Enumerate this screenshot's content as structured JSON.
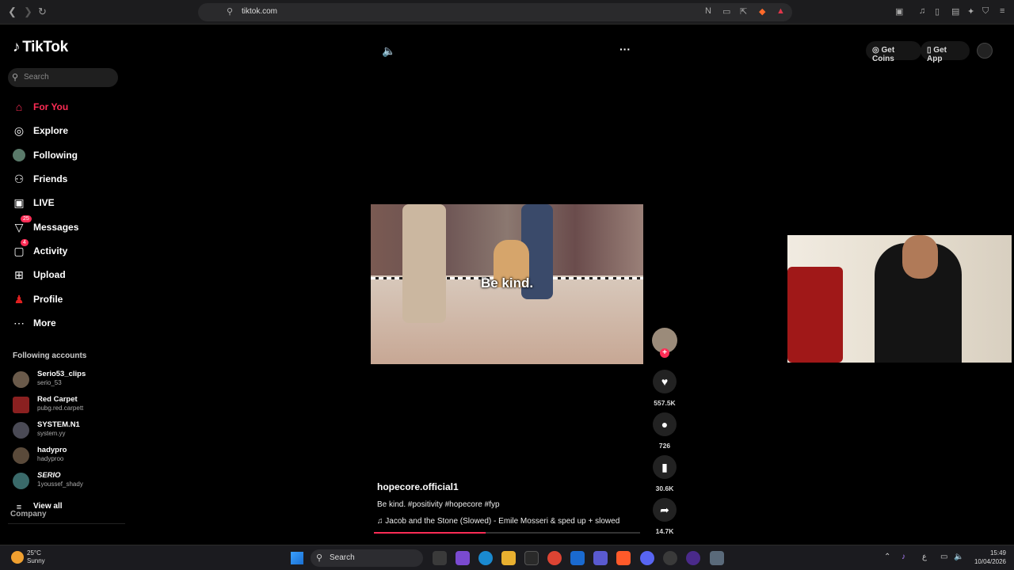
{
  "browser": {
    "url": "tiktok.com"
  },
  "sidebar": {
    "logo": "TikTok",
    "search_placeholder": "Search",
    "nav": [
      {
        "label": "For You",
        "icon": "home-icon",
        "badge": ""
      },
      {
        "label": "Explore",
        "icon": "compass-icon",
        "badge": ""
      },
      {
        "label": "Following",
        "icon": "following-icon",
        "badge": ""
      },
      {
        "label": "Friends",
        "icon": "friends-icon",
        "badge": ""
      },
      {
        "label": "LIVE",
        "icon": "live-icon",
        "badge": ""
      },
      {
        "label": "Messages",
        "icon": "messages-icon",
        "badge": "25"
      },
      {
        "label": "Activity",
        "icon": "activity-icon",
        "badge": "4"
      },
      {
        "label": "Upload",
        "icon": "upload-icon",
        "badge": ""
      },
      {
        "label": "Profile",
        "icon": "profile-icon",
        "badge": ""
      },
      {
        "label": "More",
        "icon": "more-icon",
        "badge": ""
      }
    ],
    "following_title": "Following accounts",
    "accounts": [
      {
        "name": "Serio53_clips",
        "handle": "serio_53"
      },
      {
        "name": "Red Carpet",
        "handle": "pubg.red.carpett"
      },
      {
        "name": "SYSTEM.N1",
        "handle": "system.yy"
      },
      {
        "name": "hadypro",
        "handle": "hadyproo"
      },
      {
        "name": "SERIO",
        "handle": "1youssef_shady"
      }
    ],
    "view_all": "View all",
    "company": "Company"
  },
  "header": {
    "get_coins": "Get Coins",
    "get_app": "Get App"
  },
  "video": {
    "caption_overlay": "Be kind.",
    "author": "hopecore.official1",
    "description": "Be kind. #positivity #hopecore #fyp",
    "music": "Jacob and the Stone (Slowed) - Emile Mosseri & sped up + slowed",
    "progress": 0.42
  },
  "actions": {
    "likes": "557.5K",
    "comments": "726",
    "saves": "30.6K",
    "shares": "14.7K"
  },
  "taskbar": {
    "temperature": "25°C",
    "condition": "Sunny",
    "search": "Search",
    "time": "15:49",
    "date": "10/04/2026"
  },
  "colors": {
    "accent": "#fe2c55",
    "background": "#000000"
  }
}
